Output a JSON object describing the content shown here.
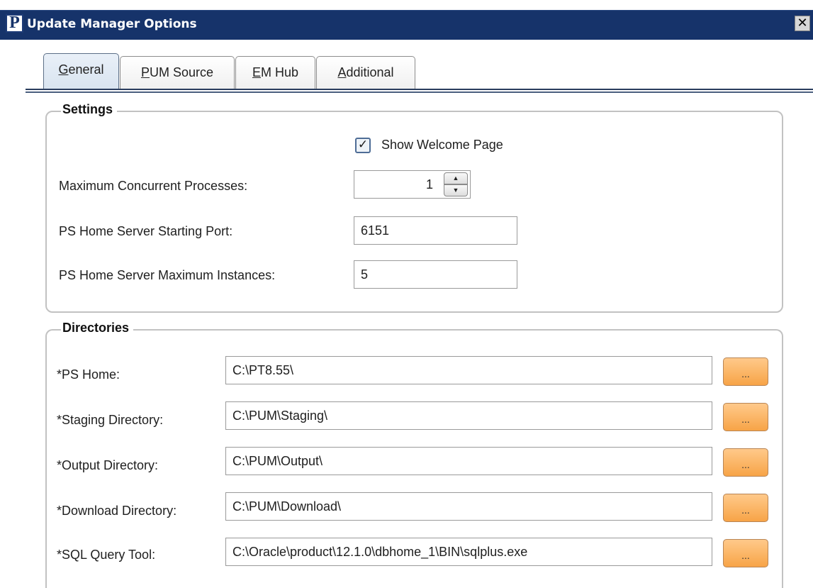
{
  "window": {
    "title": "Update Manager Options",
    "app_icon_letter": "P",
    "close_glyph": "✕"
  },
  "tabs": [
    {
      "label": "General",
      "mnemonic": "G",
      "rest": "eneral",
      "active": true
    },
    {
      "label": "PUM Source",
      "mnemonic": "P",
      "rest": "UM Source",
      "active": false
    },
    {
      "label": "EM Hub",
      "mnemonic": "E",
      "rest": "M Hub",
      "active": false
    },
    {
      "label": "Additional",
      "mnemonic": "A",
      "rest": "dditional",
      "active": false
    }
  ],
  "settings": {
    "legend": "Settings",
    "show_welcome": {
      "label": "Show Welcome Page",
      "checked": true
    },
    "max_concurrent": {
      "label": "Maximum Concurrent Processes:",
      "value": "1"
    },
    "starting_port": {
      "label": "PS Home Server Starting Port:",
      "value": "6151"
    },
    "max_instances": {
      "label": "PS Home Server Maximum Instances:",
      "value": "5"
    }
  },
  "directories": {
    "legend": "Directories",
    "browse_label": "...",
    "ps_home": {
      "label": "*PS Home:",
      "value": "C:\\PT8.55\\"
    },
    "staging": {
      "label": "*Staging Directory:",
      "value": "C:\\PUM\\Staging\\"
    },
    "output": {
      "label": "*Output Directory:",
      "value": "C:\\PUM\\Output\\"
    },
    "download": {
      "label": "*Download Directory:",
      "value": "C:\\PUM\\Download\\"
    },
    "sql_tool": {
      "label": "*SQL Query Tool:",
      "value": "C:\\Oracle\\product\\12.1.0\\dbhome_1\\BIN\\sqlplus.exe"
    }
  }
}
